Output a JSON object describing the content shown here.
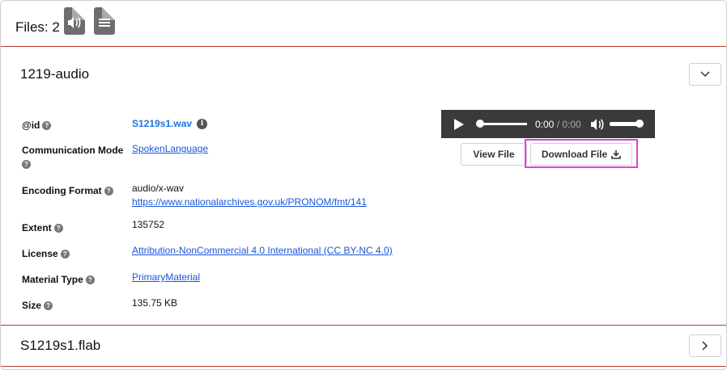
{
  "files_bar": {
    "label": "Files: 2",
    "icons": [
      "audio-file-icon",
      "text-file-icon"
    ]
  },
  "panels": [
    {
      "title": "1219-audio",
      "toggle_icon": "chevron-down-icon",
      "fields": {
        "id": {
          "label": "@id",
          "value": "S1219s1.wav"
        },
        "communication_mode": {
          "label": "Communication Mode",
          "value": "SpokenLanguage"
        },
        "encoding_format": {
          "label": "Encoding Format",
          "value": "audio/x-wav",
          "link": "https://www.nationalarchives.gov.uk/PRONOM/fmt/141"
        },
        "extent": {
          "label": "Extent",
          "value": "135752"
        },
        "license": {
          "label": "License",
          "value": "Attribution-NonCommercial 4.0 International (CC BY-NC 4.0)"
        },
        "material_type": {
          "label": "Material Type",
          "value": "PrimaryMaterial"
        },
        "size": {
          "label": "Size",
          "value": "135.75 KB"
        }
      },
      "player": {
        "current": "0:00",
        "separator": " / ",
        "total": "0:00"
      },
      "buttons": {
        "view": "View File",
        "download": "Download File"
      }
    },
    {
      "title": "S1219s1.flab",
      "toggle_icon": "chevron-right-icon"
    }
  ],
  "help_glyph": "?",
  "info_glyph": "i",
  "colors": {
    "separator": "#c0392b",
    "link": "#1a56db",
    "highlight": "#e040e0",
    "player_bg": "#3a3a3a"
  }
}
